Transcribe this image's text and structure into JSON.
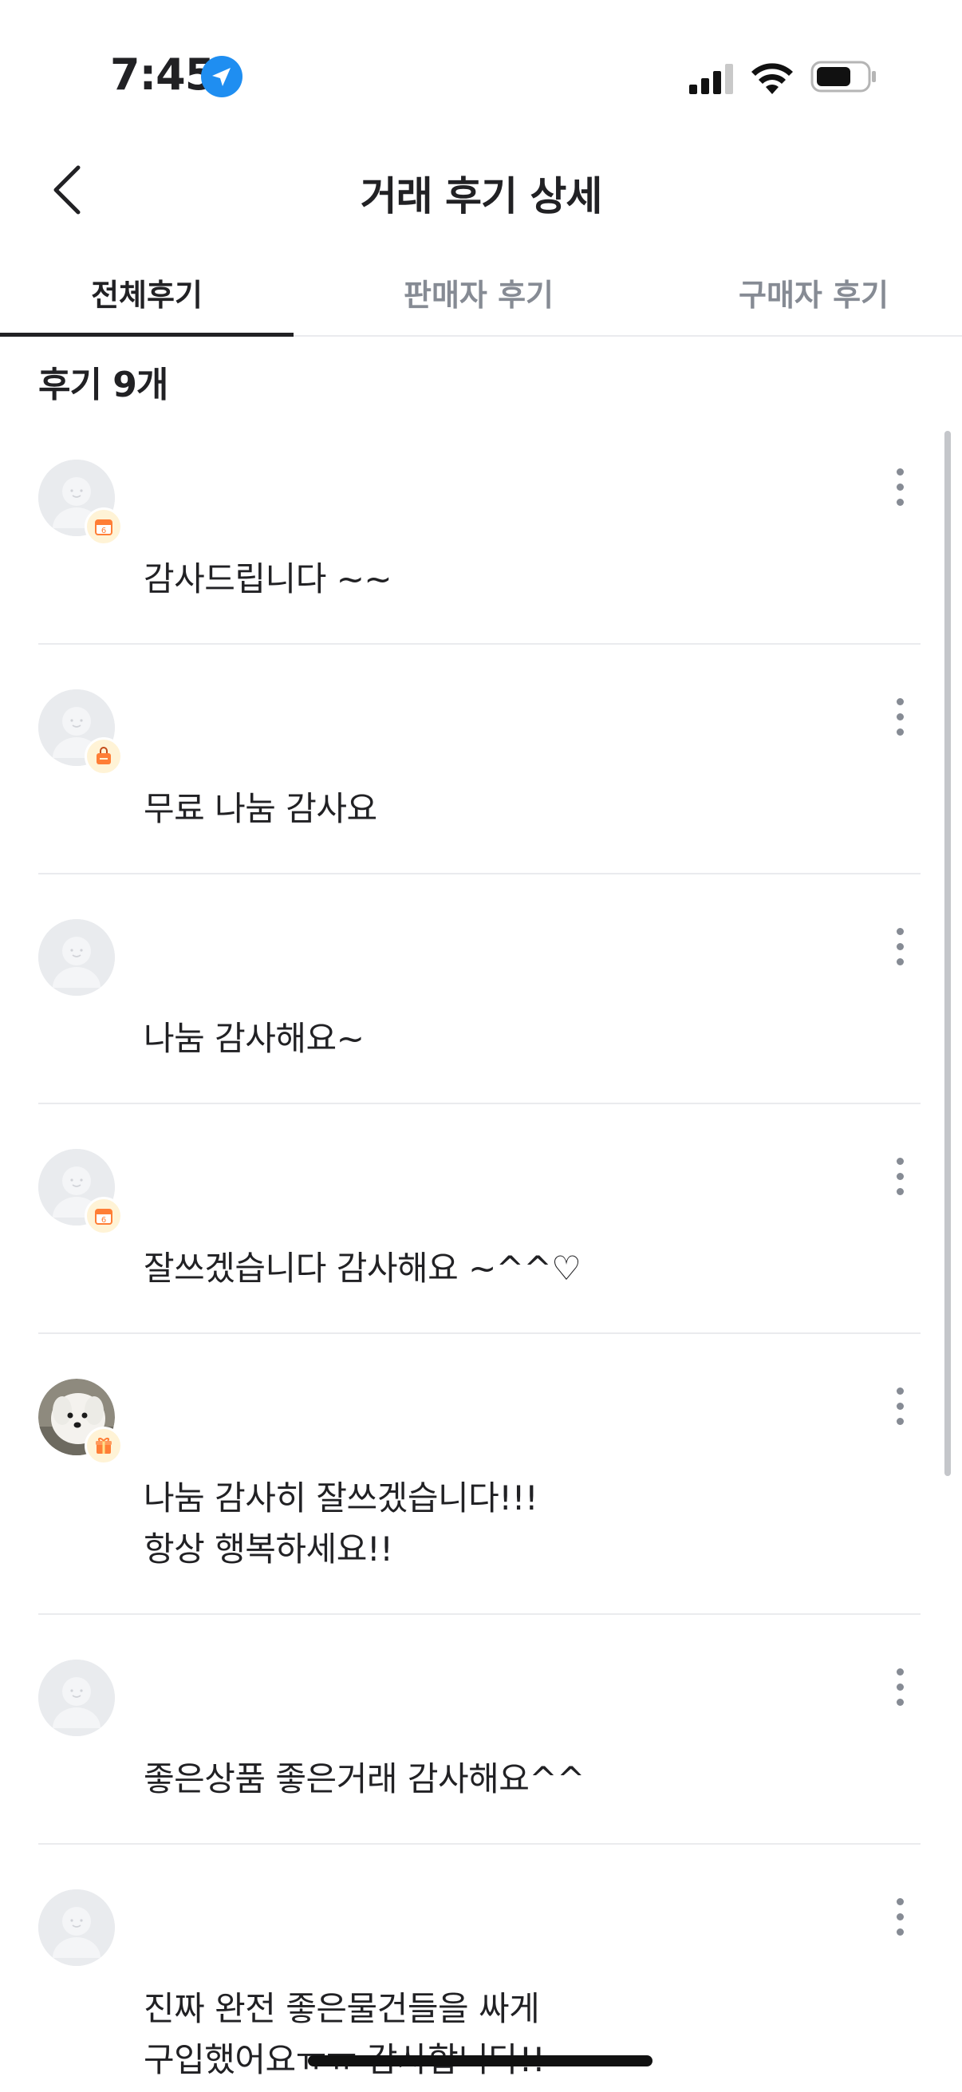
{
  "status_bar": {
    "time": "7:45",
    "icons": [
      "location-arrow-icon",
      "cellular-signal-icon",
      "wifi-icon",
      "battery-icon"
    ]
  },
  "nav": {
    "title": "거래 후기 상세",
    "back_icon": "chevron-left-icon"
  },
  "tabs": [
    {
      "label": "전체후기",
      "active": true
    },
    {
      "label": "판매자 후기",
      "active": false
    },
    {
      "label": "구매자 후기",
      "active": false
    }
  ],
  "review_count": "후기 9개",
  "reviews": [
    {
      "text": "감사드립니다 ~~",
      "avatar": "default-avatar-icon",
      "badge": "calendar-badge-icon"
    },
    {
      "text": "무료 나눔 감사요",
      "avatar": "default-avatar-icon",
      "badge": "bag-badge-icon"
    },
    {
      "text": "나눔 감사해요~",
      "avatar": "default-avatar-icon",
      "badge": null
    },
    {
      "text": "잘쓰겠습니다 감사해요 ~^^♡",
      "avatar": "default-avatar-icon",
      "badge": "calendar-badge-icon"
    },
    {
      "text": "나눔 감사히 잘쓰겠습니다!!!\n항상 행복하세요!!",
      "avatar": "dog-photo-avatar",
      "badge": "gift-badge-icon"
    },
    {
      "text": "좋은상품 좋은거래 감사해요^^",
      "avatar": "default-avatar-icon",
      "badge": null
    },
    {
      "text": "진짜 완전 좋은물건들을 싸게\n구입했어요ㅠㅠ 감사합니다!!",
      "avatar": "default-avatar-icon",
      "badge": null
    }
  ],
  "colors": {
    "text_primary": "#212124",
    "text_secondary": "#868b94",
    "divider": "#eaebee",
    "accent_blue": "#1f8ef1",
    "badge_bg": "#fff3d6",
    "badge_orange": "#ff7e36"
  }
}
